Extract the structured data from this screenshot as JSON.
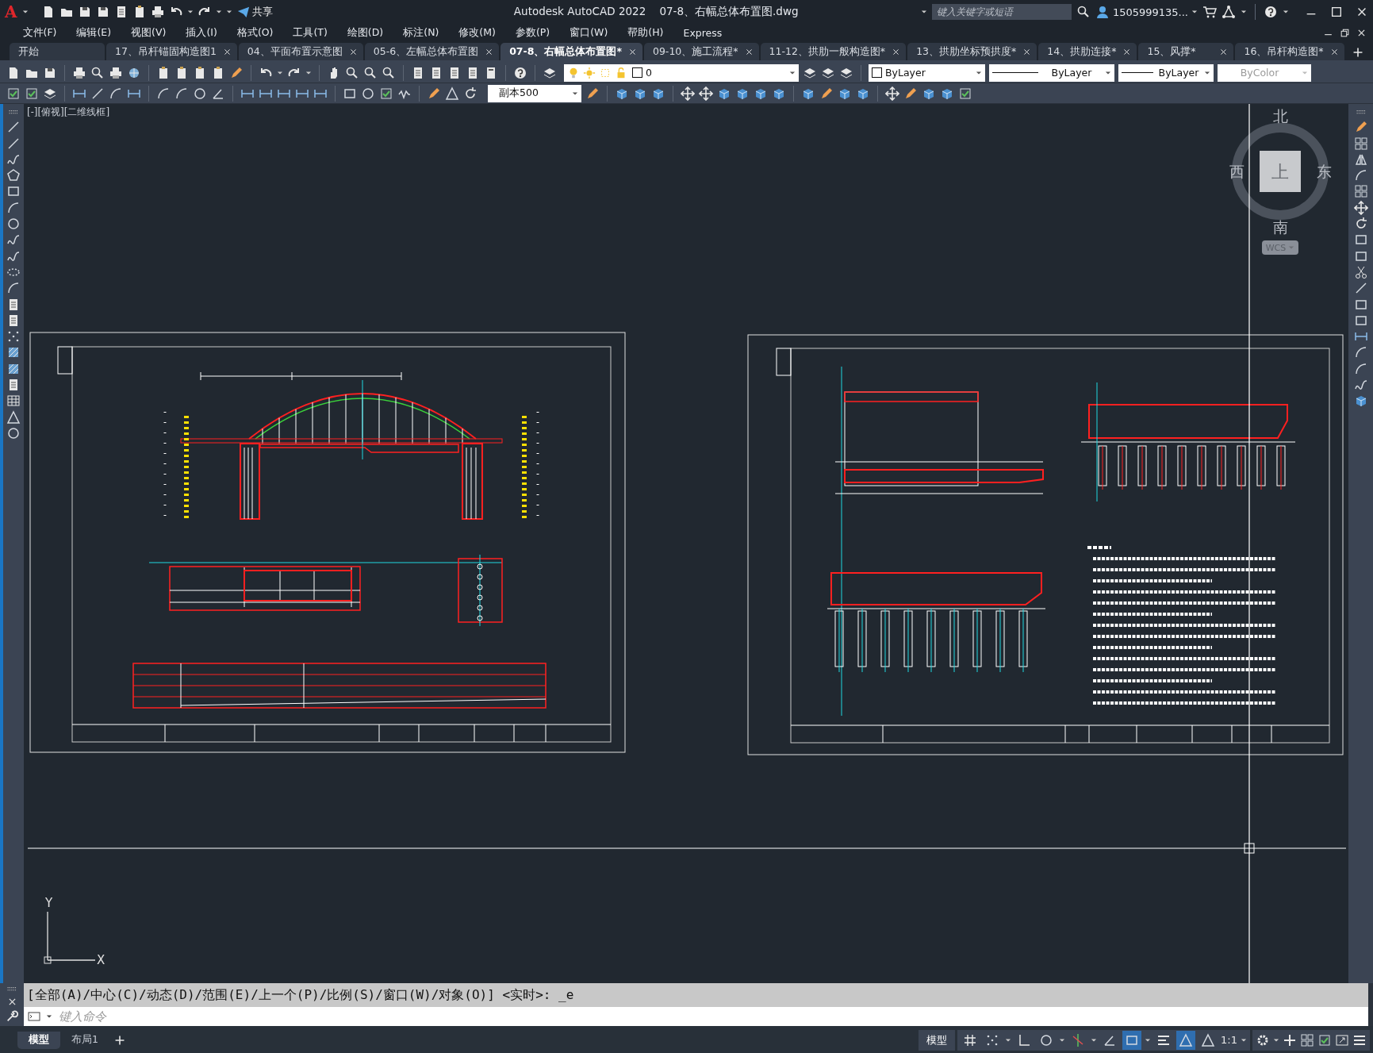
{
  "window": {
    "app_letter": "A",
    "share": "共享",
    "title": "Autodesk AutoCAD 2022    07-8、右幅总体布置图.dwg",
    "search": {
      "placeholder": "键入关键字或短语"
    },
    "user": "1505999135..."
  },
  "menu": [
    "文件(F)",
    "编辑(E)",
    "视图(V)",
    "插入(I)",
    "格式(O)",
    "工具(T)",
    "绘图(D)",
    "标注(N)",
    "修改(M)",
    "参数(P)",
    "窗口(W)",
    "帮助(H)",
    "Express"
  ],
  "tabs": [
    {
      "label": "开始",
      "selected": false,
      "closable": false
    },
    {
      "label": "17、吊杆锚固构造图1",
      "selected": false,
      "closable": true
    },
    {
      "label": "04、平面布置示意图",
      "selected": false,
      "closable": true
    },
    {
      "label": "05-6、左幅总体布置图",
      "selected": false,
      "closable": true
    },
    {
      "label": "07-8、右幅总体布置图*",
      "selected": true,
      "closable": true
    },
    {
      "label": "09-10、施工流程*",
      "selected": false,
      "closable": true
    },
    {
      "label": "11-12、拱肋一般构造图*",
      "selected": false,
      "closable": true
    },
    {
      "label": "13、拱肋坐标预拱度*",
      "selected": false,
      "closable": true
    },
    {
      "label": "14、拱肋连接*",
      "selected": false,
      "closable": true
    },
    {
      "label": "15、风撑*",
      "selected": false,
      "closable": true
    },
    {
      "label": "16、吊杆构造图*",
      "selected": false,
      "closable": true
    }
  ],
  "toolbar": {
    "layer": "0",
    "annotation_scale": "副本500",
    "properties": [
      {
        "kind": "color",
        "value": "ByLayer",
        "disabled": false
      },
      {
        "kind": "linetype",
        "value": "ByLayer",
        "disabled": false
      },
      {
        "kind": "lineweight",
        "value": "ByLayer",
        "disabled": false
      },
      {
        "kind": "plotstyle",
        "value": "ByColor",
        "disabled": true
      }
    ]
  },
  "viewport": {
    "label": "[-][俯视][二维线框]",
    "compass": {
      "north": "北",
      "south": "南",
      "east": "东",
      "west": "西",
      "face": "上"
    },
    "ucs": "WCS",
    "axis_x": "X",
    "axis_y": "Y"
  },
  "command": {
    "history": "[全部(A)/中心(C)/动态(D)/范围(E)/上一个(P)/比例(S)/窗口(W)/对象(O)] <实时>: _e",
    "placeholder": "键入命令"
  },
  "layout_tabs": [
    {
      "label": "模型",
      "selected": true
    },
    {
      "label": "布局1",
      "selected": false
    }
  ],
  "status_bar": {
    "space": "模型",
    "annotation_scale": "1:1",
    "toggles": [
      {
        "kind": "grid",
        "on": false
      },
      {
        "kind": "snap",
        "on": false
      },
      {
        "kind": "ortho",
        "on": false
      },
      {
        "kind": "polar",
        "on": false
      },
      {
        "kind": "osnap",
        "on": false
      },
      {
        "kind": "isodraft",
        "on": false
      },
      {
        "kind": "selection",
        "on": true
      },
      {
        "kind": "lineweight",
        "on": false
      },
      {
        "kind": "annovisibility",
        "on": true
      },
      {
        "kind": "autoscale",
        "on": false
      }
    ]
  }
}
